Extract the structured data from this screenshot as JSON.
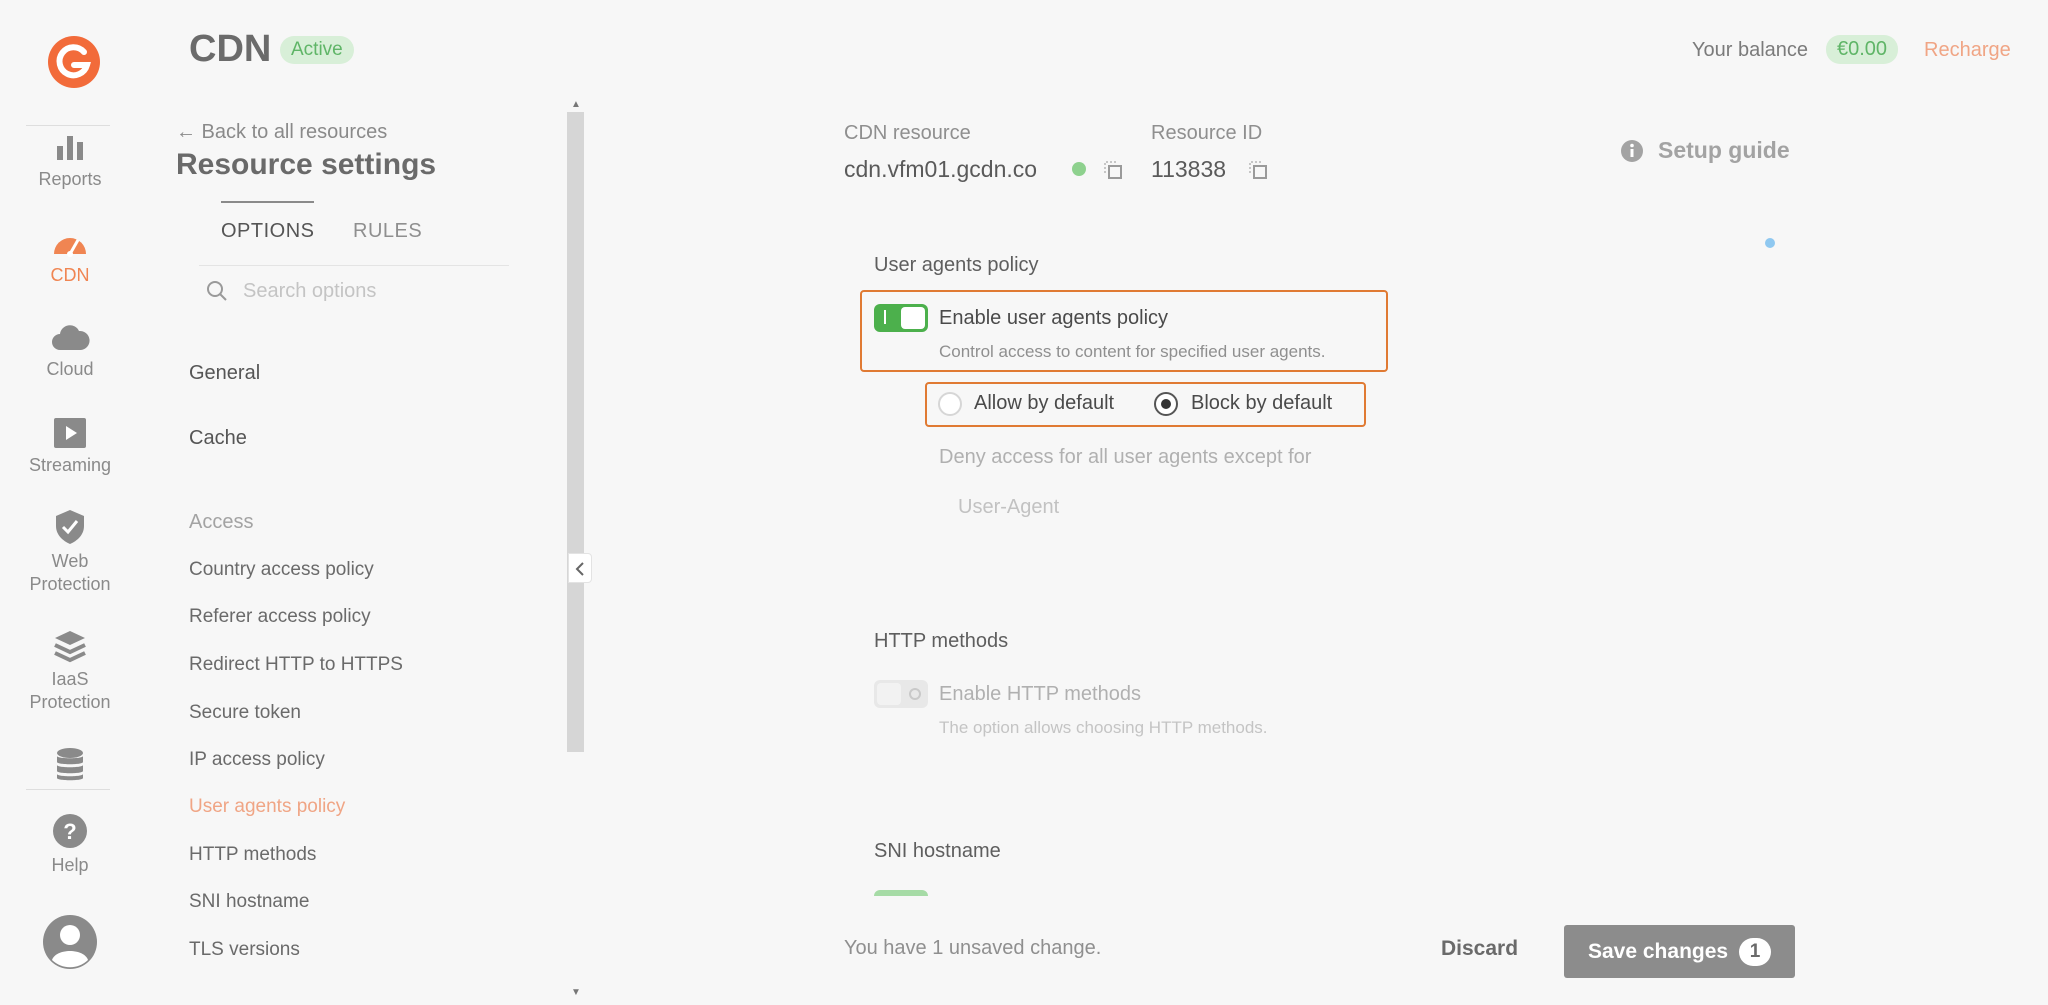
{
  "header": {
    "title": "CDN",
    "status_badge": "Active",
    "balance_label": "Your balance",
    "balance_value": "€0.00",
    "recharge_label": "Recharge"
  },
  "rail": {
    "items": [
      {
        "label": "Reports",
        "icon": "reports-icon"
      },
      {
        "label": "CDN",
        "icon": "cdn-icon",
        "active": true
      },
      {
        "label": "Cloud",
        "icon": "cloud-icon"
      },
      {
        "label": "Streaming",
        "icon": "streaming-icon"
      },
      {
        "label": "Web",
        "label2": "Protection",
        "icon": "shield-icon"
      },
      {
        "label": "IaaS",
        "label2": "Protection",
        "icon": "layers-icon"
      },
      {
        "label": "",
        "icon": "database-icon"
      },
      {
        "label": "Help",
        "icon": "help-icon"
      }
    ],
    "accent": "#f08552"
  },
  "settings": {
    "back_label": "← Back to all resources",
    "title": "Resource settings",
    "tabs": [
      "OPTIONS",
      "RULES"
    ],
    "search_placeholder": "Search options",
    "menu": {
      "general": "General",
      "cache": "Cache",
      "access": "Access",
      "country": "Country access policy",
      "referer": "Referer access policy",
      "redirect": "Redirect HTTP to HTTPS",
      "secure_token": "Secure token",
      "ip": "IP access policy",
      "user_agents": "User agents policy",
      "http_methods": "HTTP methods",
      "sni": "SNI hostname",
      "tls": "TLS versions"
    }
  },
  "resource": {
    "cdn_label": "CDN resource",
    "cdn_value": "cdn.vfm01.gcdn.co",
    "id_label": "Resource ID",
    "id_value": "113838",
    "setup_guide": "Setup guide"
  },
  "user_agents": {
    "section_title": "User agents policy",
    "toggle_label": "Enable user agents policy",
    "toggle_desc": "Control access to content for specified user agents.",
    "toggle_on": true,
    "allow_label": "Allow by default",
    "block_label": "Block by default",
    "selected": "block",
    "deny_text": "Deny access for all user agents except for",
    "ua_placeholder": "User-Agent"
  },
  "http_methods": {
    "section_title": "HTTP methods",
    "toggle_label": "Enable HTTP methods",
    "toggle_desc": "The option allows choosing HTTP methods.",
    "toggle_on": false
  },
  "sni": {
    "section_title": "SNI hostname"
  },
  "footer": {
    "unsaved_text": "You have 1 unsaved change.",
    "discard_label": "Discard",
    "save_label": "Save changes",
    "save_count": "1"
  },
  "colors": {
    "highlight": "#e07a33",
    "toggle_on": "#4cb04c",
    "status_green": "#8ed18e"
  }
}
